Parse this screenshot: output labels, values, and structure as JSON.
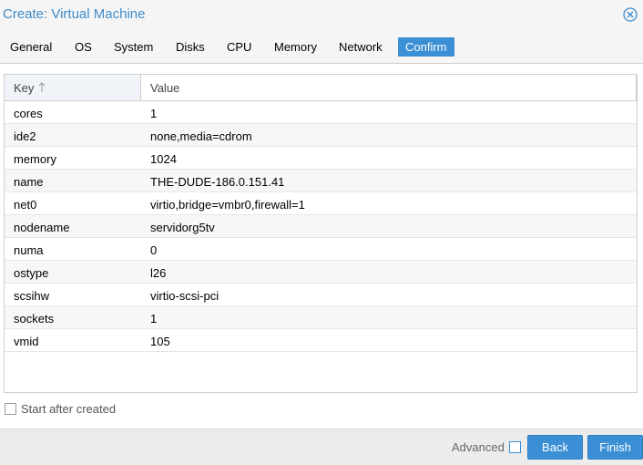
{
  "window": {
    "title": "Create: Virtual Machine"
  },
  "tabs": [
    "General",
    "OS",
    "System",
    "Disks",
    "CPU",
    "Memory",
    "Network",
    "Confirm"
  ],
  "active_tab": "Confirm",
  "grid": {
    "columns": {
      "key": "Key",
      "value": "Value"
    },
    "sort": "Key ascending",
    "rows": [
      {
        "key": "cores",
        "value": "1"
      },
      {
        "key": "ide2",
        "value": "none,media=cdrom"
      },
      {
        "key": "memory",
        "value": "1024"
      },
      {
        "key": "name",
        "value": "THE-DUDE-186.0.151.41"
      },
      {
        "key": "net0",
        "value": "virtio,bridge=vmbr0,firewall=1"
      },
      {
        "key": "nodename",
        "value": "servidorg5tv"
      },
      {
        "key": "numa",
        "value": "0"
      },
      {
        "key": "ostype",
        "value": "l26"
      },
      {
        "key": "scsihw",
        "value": "virtio-scsi-pci"
      },
      {
        "key": "sockets",
        "value": "1"
      },
      {
        "key": "vmid",
        "value": "105"
      }
    ]
  },
  "options": {
    "start_after_created": {
      "label": "Start after created",
      "checked": false
    }
  },
  "footer": {
    "advanced": {
      "label": "Advanced",
      "checked": false
    },
    "back_label": "Back",
    "finish_label": "Finish"
  },
  "colors": {
    "accent": "#3b8fd4",
    "title": "#3f8cc9"
  }
}
